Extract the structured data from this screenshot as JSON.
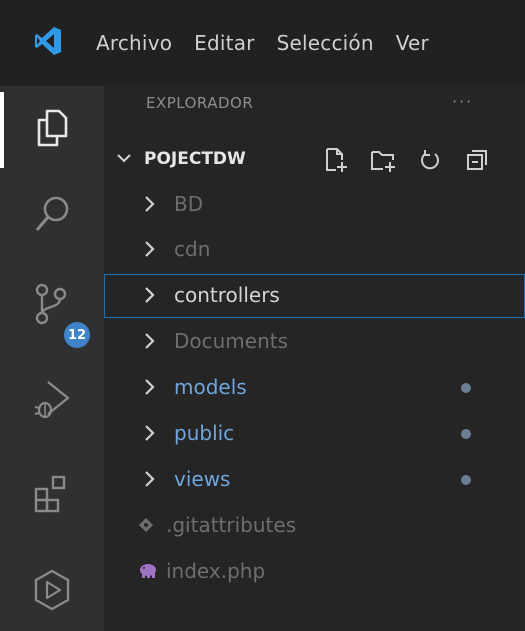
{
  "menubar": {
    "items": [
      "Archivo",
      "Editar",
      "Selección",
      "Ver"
    ]
  },
  "activity_bar": {
    "items": [
      "explorer",
      "search",
      "source-control",
      "run-and-debug",
      "extensions",
      "remote-explorer"
    ],
    "source_control_badge": "12"
  },
  "explorer": {
    "title": "EXPLORADOR",
    "more": "···",
    "section": "POJECTDW",
    "tree": [
      {
        "name": "BD",
        "kind": "folder",
        "style": "dim"
      },
      {
        "name": "cdn",
        "kind": "folder",
        "style": "dim"
      },
      {
        "name": "controllers",
        "kind": "folder",
        "style": "normal",
        "selected": true
      },
      {
        "name": "Documents",
        "kind": "folder",
        "style": "dim"
      },
      {
        "name": "models",
        "kind": "folder",
        "style": "modified"
      },
      {
        "name": "public",
        "kind": "folder",
        "style": "modified"
      },
      {
        "name": "views",
        "kind": "folder",
        "style": "modified"
      },
      {
        "name": ".gitattributes",
        "kind": "file",
        "style": "dim"
      },
      {
        "name": "index.php",
        "kind": "file",
        "style": "dim"
      }
    ]
  },
  "colors": {
    "accent_blue": "#3f84c8",
    "modified_text": "#6fa5db",
    "selection_border": "#1e72b5",
    "php_icon": "#a074c4"
  }
}
